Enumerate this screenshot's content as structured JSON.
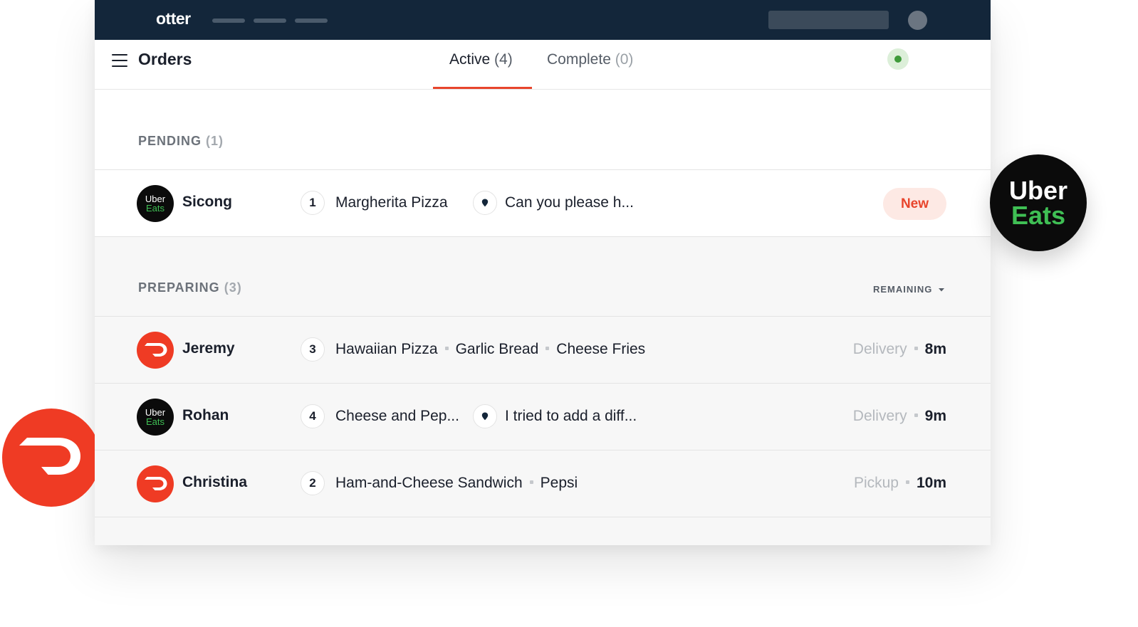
{
  "topbar": {
    "brand": "otter"
  },
  "header": {
    "title": "Orders",
    "tabs": [
      {
        "label": "Active",
        "count": "(4)"
      },
      {
        "label": "Complete",
        "count": "(0)"
      }
    ]
  },
  "sections": {
    "pending": {
      "label": "PENDING",
      "count": "(1)"
    },
    "preparing": {
      "label": "PREPARING",
      "count": "(3)",
      "sort_label": "REMAINING"
    }
  },
  "logos": {
    "uber_line1": "Uber",
    "uber_line2": "Eats"
  },
  "orders": [
    {
      "customer": "Sicong",
      "provider": "Uber Eats",
      "qty": "1",
      "items": [
        "Margherita Pizza"
      ],
      "note": "Can you please h...",
      "badge": "New"
    },
    {
      "customer": "Jeremy",
      "provider": "DoorDash",
      "qty": "3",
      "items": [
        "Hawaiian Pizza",
        "Garlic Bread",
        "Cheese Fries"
      ],
      "type": "Delivery",
      "time": "8m"
    },
    {
      "customer": "Rohan",
      "provider": "Uber Eats",
      "qty": "4",
      "items": [
        "Cheese and Pep..."
      ],
      "note": "I tried to add a diff...",
      "type": "Delivery",
      "time": "9m"
    },
    {
      "customer": "Christina",
      "provider": "DoorDash",
      "qty": "2",
      "items": [
        "Ham-and-Cheese Sandwich",
        "Pepsi"
      ],
      "type": "Pickup",
      "time": "10m"
    }
  ],
  "colors": {
    "topbar": "#13263a",
    "accent": "#e8452c",
    "uber_green": "#3fbf54",
    "doordash_red": "#ef3b24"
  }
}
